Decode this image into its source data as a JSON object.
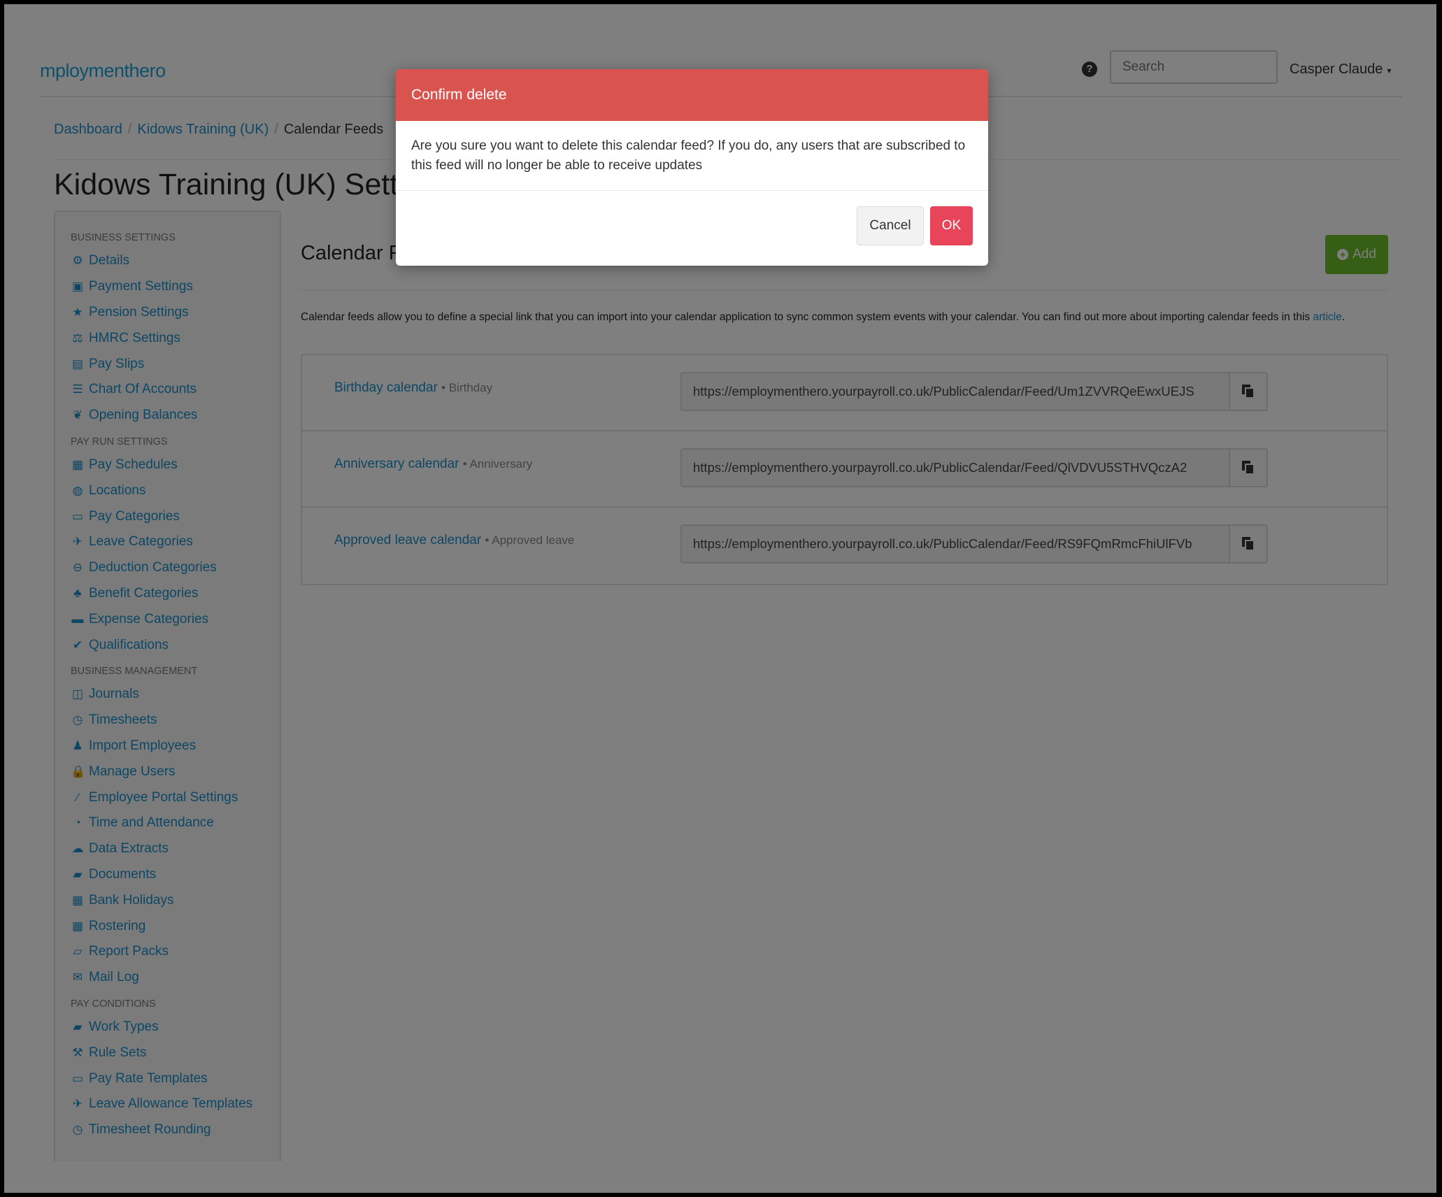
{
  "header": {
    "logo": "mploymenthero",
    "help_icon": "question-circle-icon",
    "search_placeholder": "Search",
    "user_name": "Casper Claude",
    "caret": "▾"
  },
  "breadcrumb": {
    "items": [
      "Dashboard",
      "Kidows Training (UK)"
    ],
    "current": "Calendar Feeds",
    "separator": "/"
  },
  "page": {
    "title": "Kidows Training (UK) Settings"
  },
  "sidebar": {
    "sections": [
      {
        "title": "BUSINESS SETTINGS",
        "items": [
          {
            "label": "Details",
            "icon": "gear-icon",
            "glyph": "⚙"
          },
          {
            "label": "Payment Settings",
            "icon": "save-icon",
            "glyph": "▣"
          },
          {
            "label": "Pension Settings",
            "icon": "star-icon",
            "glyph": "★"
          },
          {
            "label": "HMRC Settings",
            "icon": "scale-icon",
            "glyph": "⚖"
          },
          {
            "label": "Pay Slips",
            "icon": "file-icon",
            "glyph": "▤"
          },
          {
            "label": "Chart Of Accounts",
            "icon": "list-icon",
            "glyph": "☰"
          },
          {
            "label": "Opening Balances",
            "icon": "leaf-icon",
            "glyph": "❦"
          }
        ]
      },
      {
        "title": "PAY RUN SETTINGS",
        "items": [
          {
            "label": "Pay Schedules",
            "icon": "calendar-icon",
            "glyph": "▦"
          },
          {
            "label": "Locations",
            "icon": "globe-icon",
            "glyph": "◍"
          },
          {
            "label": "Pay Categories",
            "icon": "money-icon",
            "glyph": "▭"
          },
          {
            "label": "Leave Categories",
            "icon": "plane-icon",
            "glyph": "✈"
          },
          {
            "label": "Deduction Categories",
            "icon": "minus-circle-icon",
            "glyph": "⊖"
          },
          {
            "label": "Benefit Categories",
            "icon": "benefit-icon",
            "glyph": "♣"
          },
          {
            "label": "Expense Categories",
            "icon": "archive-icon",
            "glyph": "▬"
          },
          {
            "label": "Qualifications",
            "icon": "check-icon",
            "glyph": "✔"
          }
        ]
      },
      {
        "title": "BUSINESS MANAGEMENT",
        "items": [
          {
            "label": "Journals",
            "icon": "book-icon",
            "glyph": "◫"
          },
          {
            "label": "Timesheets",
            "icon": "clock-icon",
            "glyph": "◷"
          },
          {
            "label": "Import Employees",
            "icon": "users-icon",
            "glyph": "♟"
          },
          {
            "label": "Manage Users",
            "icon": "lock-icon",
            "glyph": "🔒"
          },
          {
            "label": "Employee Portal Settings",
            "icon": "magic-wand-icon",
            "glyph": "⁄"
          },
          {
            "label": "Time and Attendance",
            "icon": "user-clock-icon",
            "glyph": "◔"
          },
          {
            "label": "Data Extracts",
            "icon": "cloud-download-icon",
            "glyph": "☁"
          },
          {
            "label": "Documents",
            "icon": "folder-icon",
            "glyph": "▰"
          },
          {
            "label": "Bank Holidays",
            "icon": "calendar-icon",
            "glyph": "▦"
          },
          {
            "label": "Rostering",
            "icon": "calendar-alt-icon",
            "glyph": "▦"
          },
          {
            "label": "Report Packs",
            "icon": "folder-open-icon",
            "glyph": "▱"
          },
          {
            "label": "Mail Log",
            "icon": "envelope-icon",
            "glyph": "✉"
          }
        ]
      },
      {
        "title": "PAY CONDITIONS",
        "items": [
          {
            "label": "Work Types",
            "icon": "book-icon",
            "glyph": "▰"
          },
          {
            "label": "Rule Sets",
            "icon": "gavel-icon",
            "glyph": "⚒"
          },
          {
            "label": "Pay Rate Templates",
            "icon": "money-icon",
            "glyph": "▭"
          },
          {
            "label": "Leave Allowance Templates",
            "icon": "plane-icon",
            "glyph": "✈"
          },
          {
            "label": "Timesheet Rounding",
            "icon": "clock-icon",
            "glyph": "◷"
          }
        ]
      }
    ]
  },
  "main": {
    "title": "Calendar Feeds",
    "add_label": "Add",
    "description": "Calendar feeds allow you to define a special link that you can import into your calendar application to sync common system events with your calendar. You can find out more about importing calendar feeds in this ",
    "description_link": "article",
    "description_end": ".",
    "feeds": [
      {
        "name": "Birthday calendar",
        "type": "Birthday",
        "url": "https://employmenthero.yourpayroll.co.uk/PublicCalendar/Feed/Um1ZVVRQeEwxUEJS"
      },
      {
        "name": "Anniversary calendar",
        "type": "Anniversary",
        "url": "https://employmenthero.yourpayroll.co.uk/PublicCalendar/Feed/QlVDVU5STHVQczA2"
      },
      {
        "name": "Approved leave calendar",
        "type": "Approved leave",
        "url": "https://employmenthero.yourpayroll.co.uk/PublicCalendar/Feed/RS9FQmRmcFhiUlFVb"
      }
    ]
  },
  "modal": {
    "title": "Confirm delete",
    "body": "Are you sure you want to delete this calendar feed? If you do, any users that are subscribed to this feed will no longer be able to receive updates",
    "cancel_label": "Cancel",
    "ok_label": "OK"
  },
  "colors": {
    "link": "#1a8fc9",
    "modal_header": "#d9534f",
    "ok_button": "#e8455a",
    "add_button": "#6cbe2a"
  }
}
